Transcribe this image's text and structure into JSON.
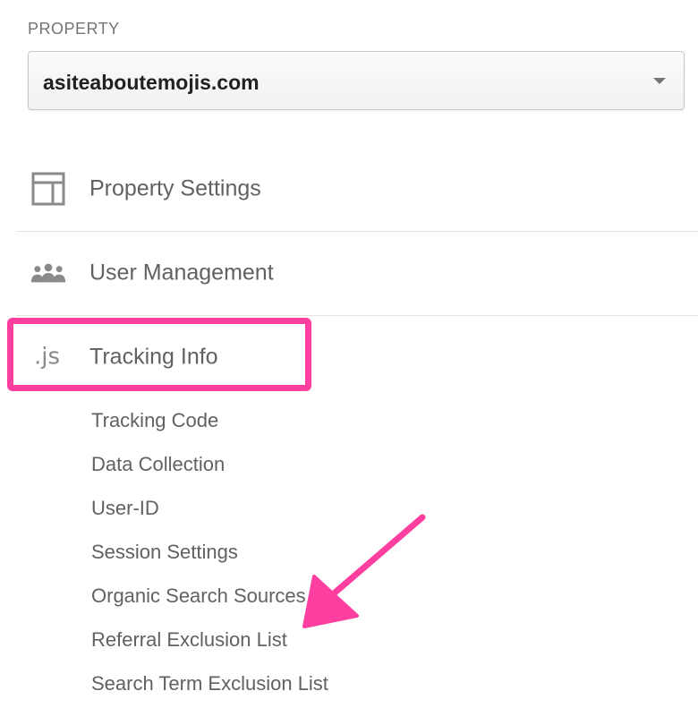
{
  "property": {
    "section_label": "PROPERTY",
    "selected_value": "asiteaboutemojis.com"
  },
  "nav": {
    "property_settings": {
      "label": "Property Settings",
      "icon": "layout-panel-icon"
    },
    "user_management": {
      "label": "User Management",
      "icon": "users-group-icon"
    },
    "tracking_info": {
      "label": "Tracking Info",
      "icon": "js-icon",
      "icon_text": ".js"
    }
  },
  "tracking_submenu": [
    "Tracking Code",
    "Data Collection",
    "User-ID",
    "Session Settings",
    "Organic Search Sources",
    "Referral Exclusion List",
    "Search Term Exclusion List"
  ],
  "annotation": {
    "highlight_color": "#ff3fa0",
    "arrow_color": "#ff3fa0"
  }
}
